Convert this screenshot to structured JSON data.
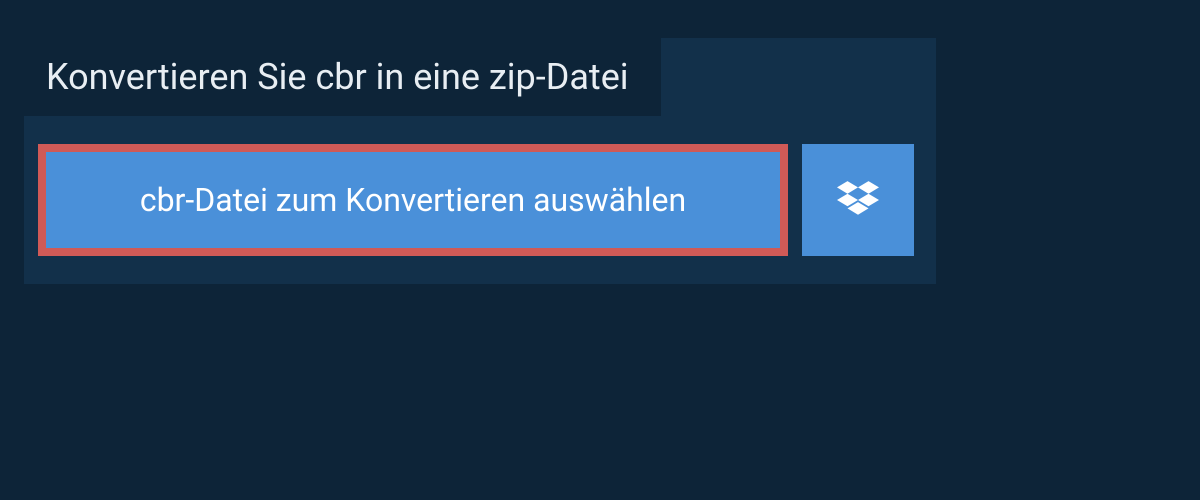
{
  "header": {
    "title": "Konvertieren Sie cbr in eine zip-Datei"
  },
  "actions": {
    "select_file_label": "cbr-Datei zum Konvertieren auswählen"
  },
  "colors": {
    "background": "#0d2438",
    "panel": "#12304a",
    "button": "#4a90d9",
    "highlight_border": "#d05a57",
    "text_light": "#e8eef3",
    "text_white": "#ffffff"
  }
}
